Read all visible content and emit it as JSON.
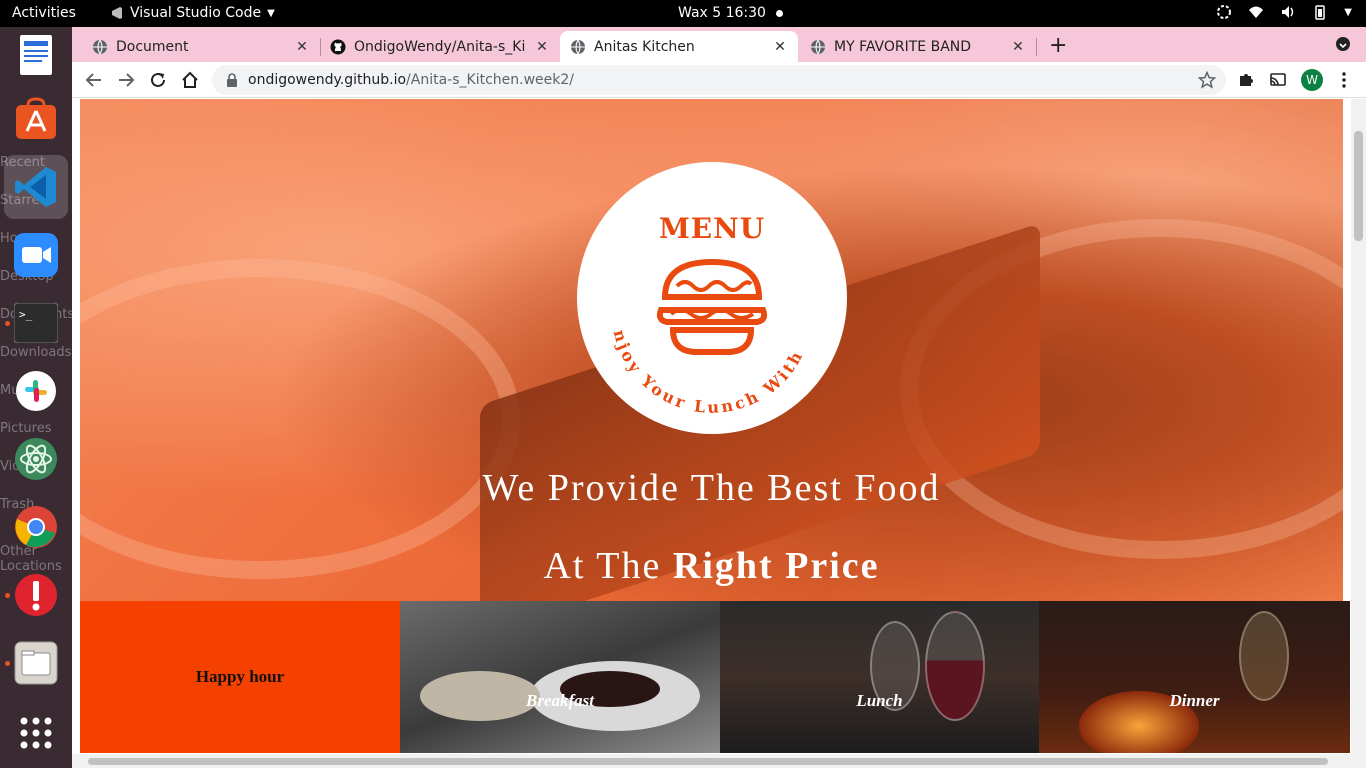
{
  "topbar": {
    "activities": "Activities",
    "app_name": "Visual Studio Code",
    "clock": "Wax 5  16:30"
  },
  "dock": {
    "ghost_labels": [
      "Recent",
      "Starred",
      "Home",
      "Desktop",
      "Documents",
      "Downloads",
      "Music",
      "Pictures",
      "Videos",
      "Trash",
      "Other Locations"
    ],
    "apps": [
      "libreoffice-writer",
      "ubuntu-software",
      "visual-studio-code",
      "zoom",
      "terminal",
      "slack",
      "atom",
      "chrome",
      "update-notifier",
      "files",
      "show-applications"
    ]
  },
  "tabs": [
    {
      "title": "Document",
      "active": false
    },
    {
      "title": "OndigoWendy/Anita-s_Ki",
      "active": false
    },
    {
      "title": "Anitas Kitchen",
      "active": true
    },
    {
      "title": "MY FAVORITE BAND",
      "active": false
    }
  ],
  "address": {
    "host": "ondigowendy.github.io",
    "path": "/Anita-s_Kitchen.week2/"
  },
  "profile_initial": "W",
  "hero": {
    "logo_title": "MENU",
    "logo_tagline": "Enjoy Your Lunch With Us",
    "line1": "We Provide The Best Food",
    "line2_prefix": "At The ",
    "line2_bold": "Right Price"
  },
  "cards": [
    {
      "label": "Happy hour"
    },
    {
      "label": "Breakfast"
    },
    {
      "label": "Lunch"
    },
    {
      "label": "Dinner"
    }
  ],
  "colors": {
    "accent": "#e84a10",
    "happy_hour_bg": "#f54100",
    "tabstrip": "#f6c6d9"
  }
}
